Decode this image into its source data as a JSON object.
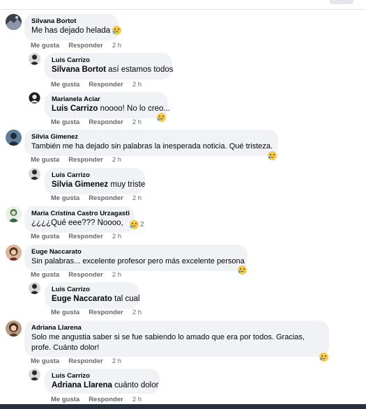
{
  "colors": {
    "bubble_bg": "#f0f2f5",
    "meta_text": "#65676b",
    "emoji_face": "#f7c94a",
    "emoji_tear": "#4fa6e8"
  },
  "comments": [
    {
      "author": "Silvana Bortot",
      "mention": "",
      "text": "Me has dejado helada",
      "like": "Me gusta",
      "reply": "Responder",
      "time": "2 h",
      "emoji": "sad-tear-emoji"
    },
    {
      "author": "Luis Carrizo",
      "mention": "Silvana Bortot",
      "text": "así estamos todos",
      "like": "Me gusta",
      "reply": "Responder",
      "time": "2 h"
    },
    {
      "author": "Marianela Aciar",
      "mention": "Luis Carrizo",
      "text": "noooo! No lo creo...",
      "like": "Me gusta",
      "reply": "Responder",
      "time": "2 h",
      "emoji": "sad-tear-emoji"
    },
    {
      "author": "Silvia Gimenez",
      "mention": "",
      "text": "También me ha dejado sin palabras la inesperada noticia. Qué tristeza.",
      "like": "Me gusta",
      "reply": "Responder",
      "time": "2 h",
      "emoji": "sad-tear-emoji"
    },
    {
      "author": "Luis Carrizo",
      "mention": "Silvia Gimenez",
      "text": "muy triste",
      "like": "Me gusta",
      "reply": "Responder",
      "time": "2 h"
    },
    {
      "author": "Maria Cristina Castro Urzagasti",
      "mention": "",
      "text": "¿¿¿¿Qué eee??? Noooo,",
      "like": "Me gusta",
      "reply": "Responder",
      "time": "2 h",
      "emoji": "sad-tear-emoji",
      "reaction_count": "2"
    },
    {
      "author": "Euge Naccarato",
      "mention": "",
      "text": "Sin palabras... excelente profesor pero más excelente persona",
      "like": "Me gusta",
      "reply": "Responder",
      "time": "2 h",
      "emoji": "sad-tear-emoji"
    },
    {
      "author": "Luis Carrizo",
      "mention": "Euge Naccarato",
      "text": "tal cual",
      "like": "Me gusta",
      "reply": "Responder",
      "time": "2 h"
    },
    {
      "author": "Adriana Llarena",
      "mention": "",
      "text": "Solo me angustia saber si se fue sabiendo lo amado que era por todos. Gracias,",
      "text2": "profe. Cuánto dolor!",
      "like": "Me gusta",
      "reply": "Responder",
      "time": "2 h",
      "emoji": "sad-tear-emoji"
    },
    {
      "author": "Luis Carrizo",
      "mention": "Adriana Llarena",
      "text": "cuánto dolor",
      "like": "Me gusta",
      "reply": "Responder",
      "time": "2 h"
    }
  ]
}
